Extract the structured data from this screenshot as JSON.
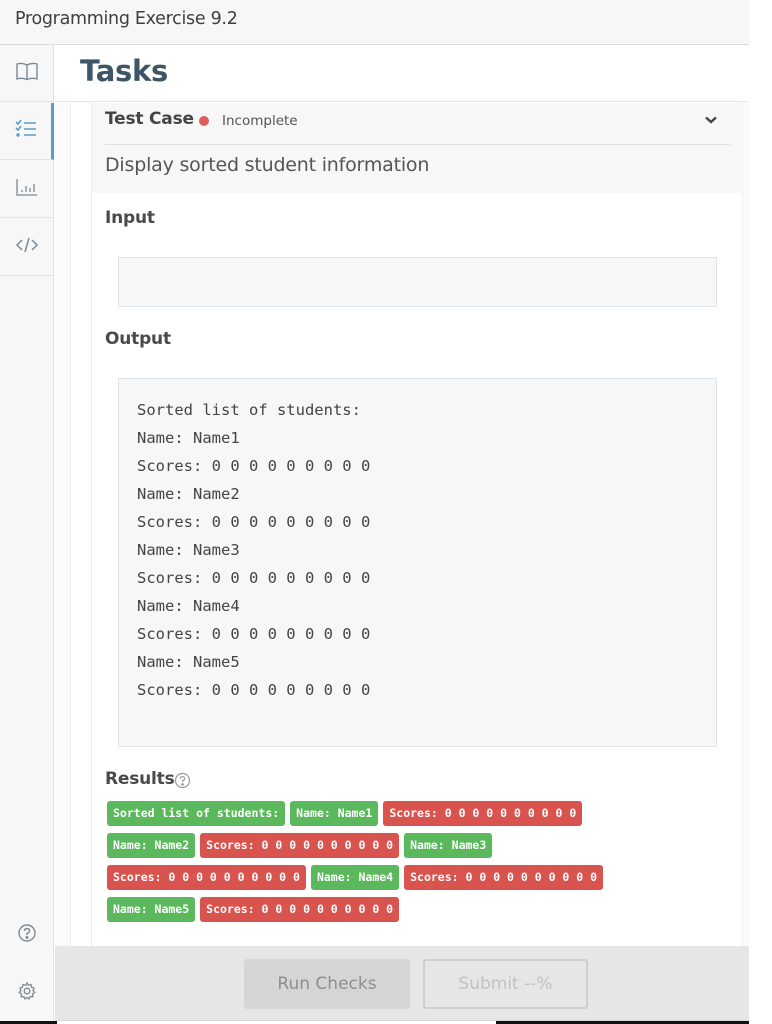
{
  "window": {
    "title": "Programming Exercise 9.2"
  },
  "sidebar": {
    "items": [
      {
        "icon": "book-icon",
        "label": "Instructions",
        "active": false
      },
      {
        "icon": "checklist-icon",
        "label": "Tasks",
        "active": true
      },
      {
        "icon": "bar-chart-icon",
        "label": "Results",
        "active": false
      },
      {
        "icon": "code-icon",
        "label": "Code",
        "active": false
      }
    ],
    "bottom": [
      {
        "icon": "help-circle-icon"
      },
      {
        "icon": "gear-icon"
      }
    ],
    "accent_color": "#5b9bc9"
  },
  "header": {
    "title": "Tasks"
  },
  "test_case": {
    "label": "Test Case",
    "status": "Incomplete",
    "status_color": "#e05d5d",
    "description": "Display sorted student information",
    "input_label": "Input",
    "input_value": "",
    "output_label": "Output",
    "output_lines": [
      "Sorted list of students:",
      "Name: Name1",
      "Scores: 0 0 0 0 0 0 0 0 0",
      "Name: Name2",
      "Scores: 0 0 0 0 0 0 0 0 0",
      "Name: Name3",
      "Scores: 0 0 0 0 0 0 0 0 0",
      "Name: Name4",
      "Scores: 0 0 0 0 0 0 0 0 0",
      "Name: Name5",
      "Scores: 0 0 0 0 0 0 0 0 0"
    ],
    "results_label": "Results",
    "results": [
      {
        "text": "Sorted list of students:",
        "status": "ok"
      },
      {
        "text": "Name: Name1",
        "status": "ok"
      },
      {
        "text": "Scores: 0 0 0 0 0 0 0 0 0 0",
        "status": "bad"
      },
      {
        "text": "Name: Name2",
        "status": "ok"
      },
      {
        "text": "Scores: 0 0 0 0 0 0 0 0 0 0",
        "status": "bad"
      },
      {
        "text": "Name: Name3",
        "status": "ok"
      },
      {
        "text": "Scores: 0 0 0 0 0 0 0 0 0 0",
        "status": "bad"
      },
      {
        "text": "Name: Name4",
        "status": "ok"
      },
      {
        "text": "Scores: 0 0 0 0 0 0 0 0 0 0",
        "status": "bad"
      },
      {
        "text": "Name: Name5",
        "status": "ok"
      },
      {
        "text": "Scores: 0 0 0 0 0 0 0 0 0 0",
        "status": "bad"
      }
    ],
    "colors": {
      "ok": "#5cb85c",
      "bad": "#d9534f"
    }
  },
  "footer": {
    "run_label": "Run Checks",
    "submit_label": "Submit --%"
  }
}
